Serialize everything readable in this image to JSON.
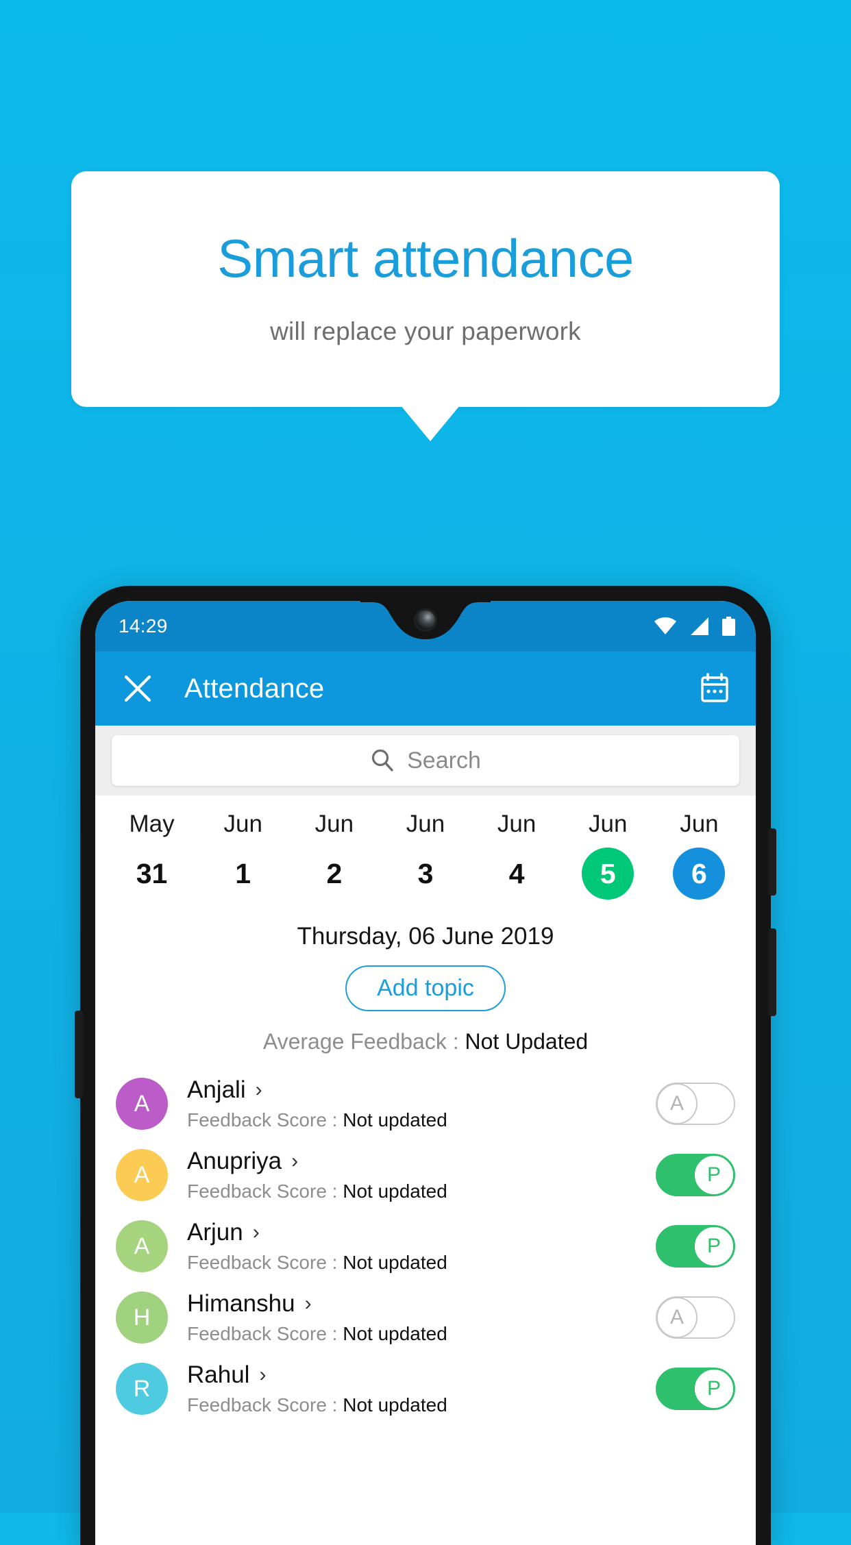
{
  "promo": {
    "headline": "Smart attendance",
    "subtitle": "will replace your paperwork",
    "bg_color": "#0fb8e8",
    "headline_color": "#1a9ddb"
  },
  "status_bar": {
    "time": "14:29",
    "icons": [
      "wifi-icon",
      "signal-icon",
      "battery-icon"
    ]
  },
  "app_bar": {
    "close_icon": "close-icon",
    "title": "Attendance",
    "calendar_icon": "calendar-icon",
    "color": "#0d98dd"
  },
  "search": {
    "placeholder": "Search",
    "icon": "search-icon",
    "value": ""
  },
  "date_strip": [
    {
      "month": "May",
      "day": "31",
      "state": "normal"
    },
    {
      "month": "Jun",
      "day": "1",
      "state": "normal"
    },
    {
      "month": "Jun",
      "day": "2",
      "state": "normal"
    },
    {
      "month": "Jun",
      "day": "3",
      "state": "normal"
    },
    {
      "month": "Jun",
      "day": "4",
      "state": "normal"
    },
    {
      "month": "Jun",
      "day": "5",
      "state": "today"
    },
    {
      "month": "Jun",
      "day": "6",
      "state": "selected"
    }
  ],
  "selected_date": "Thursday, 06 June 2019",
  "add_topic_label": "Add topic",
  "average_feedback": {
    "label": "Average Feedback : ",
    "value": "Not Updated"
  },
  "feedback_label": "Feedback Score : ",
  "students": [
    {
      "name": "Anjali",
      "initial": "A",
      "avatar_color": "#bc5cc9",
      "feedback": "Not updated",
      "attendance": "A",
      "present": false
    },
    {
      "name": "Anupriya",
      "initial": "A",
      "avatar_color": "#fbcb53",
      "feedback": "Not updated",
      "attendance": "P",
      "present": true
    },
    {
      "name": "Arjun",
      "initial": "A",
      "avatar_color": "#a5d37e",
      "feedback": "Not updated",
      "attendance": "P",
      "present": true
    },
    {
      "name": "Himanshu",
      "initial": "H",
      "avatar_color": "#9fd17f",
      "feedback": "Not updated",
      "attendance": "A",
      "present": false
    },
    {
      "name": "Rahul",
      "initial": "R",
      "avatar_color": "#4ecbe0",
      "feedback": "Not updated",
      "attendance": "P",
      "present": true
    }
  ],
  "colors": {
    "today_green": "#00c878",
    "selected_blue": "#1590dc",
    "toggle_on_green": "#2ec06d",
    "accent_blue": "#1a9ddb"
  }
}
